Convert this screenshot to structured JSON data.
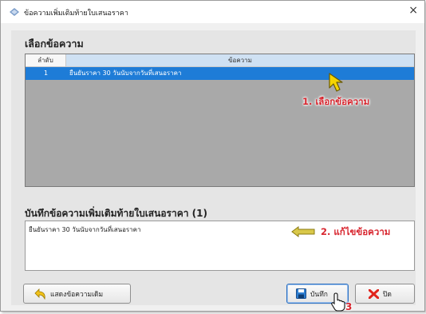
{
  "window": {
    "title": "ข้อความเพิ่มเติมท้ายใบเสนอราคา",
    "close_glyph": "×"
  },
  "section1": {
    "heading": "เลือกข้อความ"
  },
  "grid": {
    "columns": [
      "ลำดับ",
      "ข้อความ"
    ],
    "rows": [
      {
        "index": "1",
        "text": "ยืนยันราคา 30 วันนับจากวันที่เสนอราคา"
      }
    ]
  },
  "annotations": {
    "step1": "1. เลือกข้อความ",
    "step2": "2. แก้ไขข้อความ",
    "step3": "3"
  },
  "section2": {
    "heading": "บันทึกข้อความเพิ่มเติมท้ายใบเสนอราคา (1)"
  },
  "memo": {
    "value": "ยืนยันราคา 30 วันนับจากวันที่เสนอราคา"
  },
  "buttons": {
    "show_original": "แสดงข้อความเดิม",
    "save": "บันทึก",
    "close": "ปิด"
  },
  "colors": {
    "selection": "#1e7cd7",
    "annotation": "#d8262f",
    "grid_background": "#a9a9a9"
  }
}
